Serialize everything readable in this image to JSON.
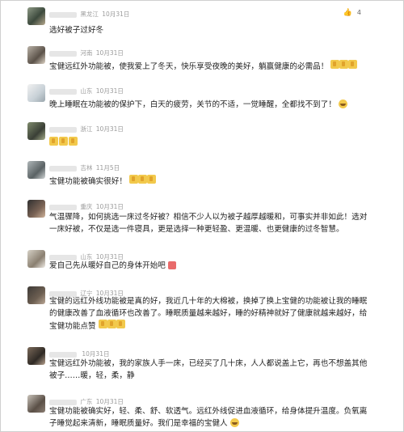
{
  "comments": [
    {
      "date": "10月31日",
      "region": "黑龙江",
      "text": "选好被子过好冬",
      "likes": "4",
      "icons": [
        "thumb-up-outline"
      ]
    },
    {
      "date": "10月31日",
      "region": "河南",
      "text": "宝健远红外功能被，使我爱上了冬天，快乐享受夜晚的美好，躺赢健康的必需品！",
      "icons": [
        "thumbs-up-emoji",
        "thumbs-up-emoji",
        "thumbs-up-emoji"
      ]
    },
    {
      "date": "10月31日",
      "region": "山东",
      "text": "晚上睡眠在功能被的保护下，白天的疲劳，关节的不适，一觉睡醒，全都找不到了！",
      "icons": [
        "grin-emoji"
      ]
    },
    {
      "date": "10月31日",
      "region": "浙江",
      "text": "",
      "icons": [
        "thumbs-up-emoji",
        "thumbs-up-emoji",
        "thumbs-up-emoji"
      ]
    },
    {
      "date": "11月5日",
      "region": "吉林",
      "text": "宝健功能被确实很好！",
      "icons": [
        "thumbs-up-emoji",
        "thumbs-up-emoji",
        "thumbs-up-emoji"
      ]
    },
    {
      "date": "10月31日",
      "region": "重庆",
      "text": "气温骤降，如何挑选一床过冬好被？相信不少人以为被子越厚越暖和，可事实并非如此！选对一床好被，不仅是选一件寝具，更是选择一种更轻盈、更温暖、也更健康的过冬智慧。",
      "icons": []
    },
    {
      "date": "10月31日",
      "region": "山东",
      "text": "爱自己先从暖好自己的身体开始吧",
      "icons": [
        "heart-emoji"
      ]
    },
    {
      "date": "10月31日",
      "region": "辽宁",
      "text": "宝健的远红外线功能被是真的好，我近几十年的大棉被，换掉了换上宝健的功能被让我的睡眠的健康改善了血液循环也改善了。睡眠质量越来越好，睡的好精神就好了健康就越来越好，给宝健功能点赞",
      "icons": [
        "thumbs-up-emoji",
        "thumbs-up-emoji",
        "thumbs-up-emoji"
      ]
    },
    {
      "date": "10月31日",
      "region": "",
      "text": "宝健远红外功能被，我的家族人手一床，已经买了几十床，人人都说盖上它，再也不想盖其他被子……暖，轻，柔，静",
      "icons": []
    },
    {
      "date": "10月31日",
      "region": "广东",
      "text": "宝健功能被确实好，轻、柔、舒、软透气。远红外线促进血液循环，给身体提升温度。负氧离子睡觉起来清新，睡眠质量好。我们是幸福的宝健人",
      "icons": [
        "grin-emoji"
      ]
    }
  ]
}
